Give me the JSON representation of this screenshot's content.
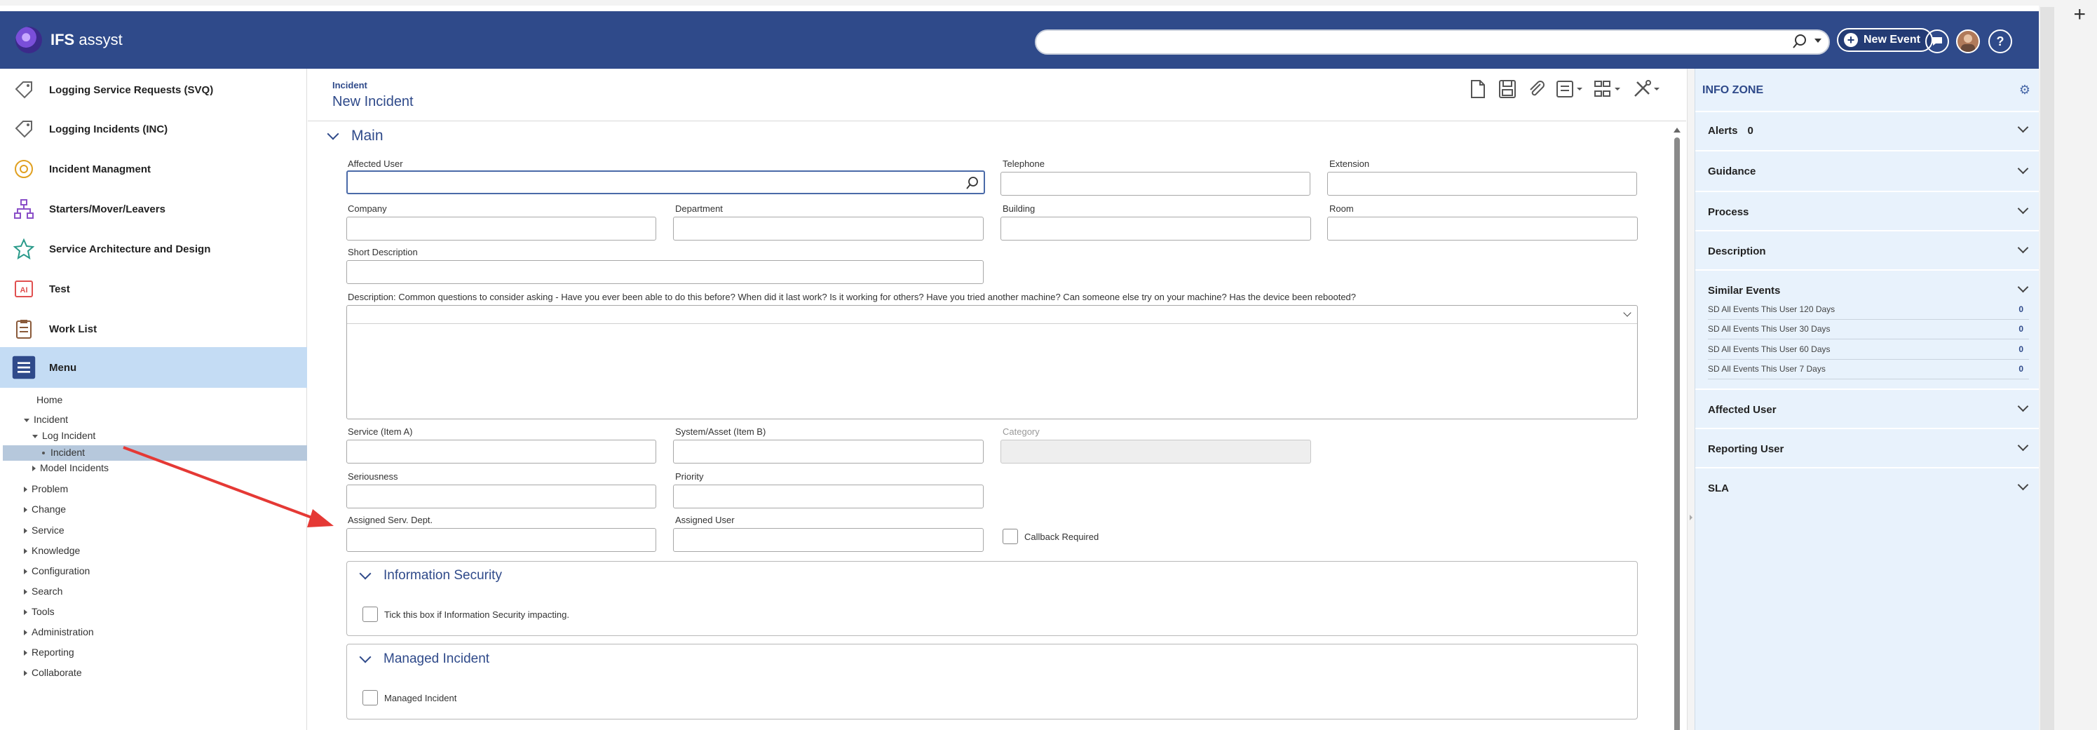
{
  "brand": {
    "name_bold": "IFS",
    "name_rest": " assyst"
  },
  "header": {
    "new_event_label": "New Event",
    "help_label": "?"
  },
  "leftnav": {
    "items": [
      {
        "label": "Logging Service Requests (SVQ)",
        "icon": "tag-icon"
      },
      {
        "label": "Logging Incidents (INC)",
        "icon": "tag-icon"
      },
      {
        "label": "Incident Managment",
        "icon": "dashboard-icon"
      },
      {
        "label": "Starters/Mover/Leavers",
        "icon": "org-chart-icon"
      },
      {
        "label": "Service Architecture and Design",
        "icon": "star-icon"
      },
      {
        "label": "Test",
        "icon": "ai-icon"
      },
      {
        "label": "Work List",
        "icon": "clipboard-icon"
      },
      {
        "label": "Menu",
        "icon": "menu-icon"
      }
    ],
    "tree": {
      "home": "Home",
      "incident": "Incident",
      "log_incident": "Log Incident",
      "incident_leaf": "Incident",
      "model_incidents": "Model Incidents",
      "problem": "Problem",
      "change": "Change",
      "service": "Service",
      "knowledge": "Knowledge",
      "configuration": "Configuration",
      "search": "Search",
      "tools": "Tools",
      "administration": "Administration",
      "reporting": "Reporting",
      "collaborate": "Collaborate"
    }
  },
  "main": {
    "breadcrumb": "Incident",
    "title": "New Incident",
    "section_main": "Main",
    "fields": {
      "affected_user": "Affected User",
      "telephone": "Telephone",
      "extension": "Extension",
      "company": "Company",
      "department": "Department",
      "building": "Building",
      "room": "Room",
      "short_description": "Short Description",
      "description": "Description: Common questions to consider asking - Have you ever been able to do this before? When did it last work? Is it working for others? Have you tried another machine? Can someone else try on your machine? Has the device been rebooted?",
      "service": "Service (Item A)",
      "system_asset": "System/Asset (Item B)",
      "category": "Category",
      "seriousness": "Seriousness",
      "priority": "Priority",
      "assigned_serv_dept": "Assigned Serv. Dept.",
      "assigned_user": "Assigned User",
      "callback_required": "Callback Required"
    },
    "info_security": {
      "title": "Information Security",
      "checkbox_label": "Tick this box if Information Security impacting."
    },
    "managed_incident": {
      "title": "Managed Incident",
      "checkbox_label": "Managed Incident"
    }
  },
  "infozone": {
    "title": "INFO ZONE",
    "alerts_label": "Alerts",
    "alerts_count": "0",
    "guidance": "Guidance",
    "process": "Process",
    "description": "Description",
    "similar_events": "Similar Events",
    "similar_items": [
      {
        "label": "SD All Events This User 120 Days",
        "value": "0"
      },
      {
        "label": "SD All Events This User 30 Days",
        "value": "0"
      },
      {
        "label": "SD All Events This User 60 Days",
        "value": "0"
      },
      {
        "label": "SD All Events This User 7 Days",
        "value": "0"
      }
    ],
    "affected_user": "Affected User",
    "reporting_user": "Reporting User",
    "sla": "SLA"
  },
  "colors": {
    "brand_bar": "#2f4a8a",
    "accent": "#2f4a8a",
    "menu_active": "#c4dcf4",
    "annotation_arrow": "#e53935"
  }
}
